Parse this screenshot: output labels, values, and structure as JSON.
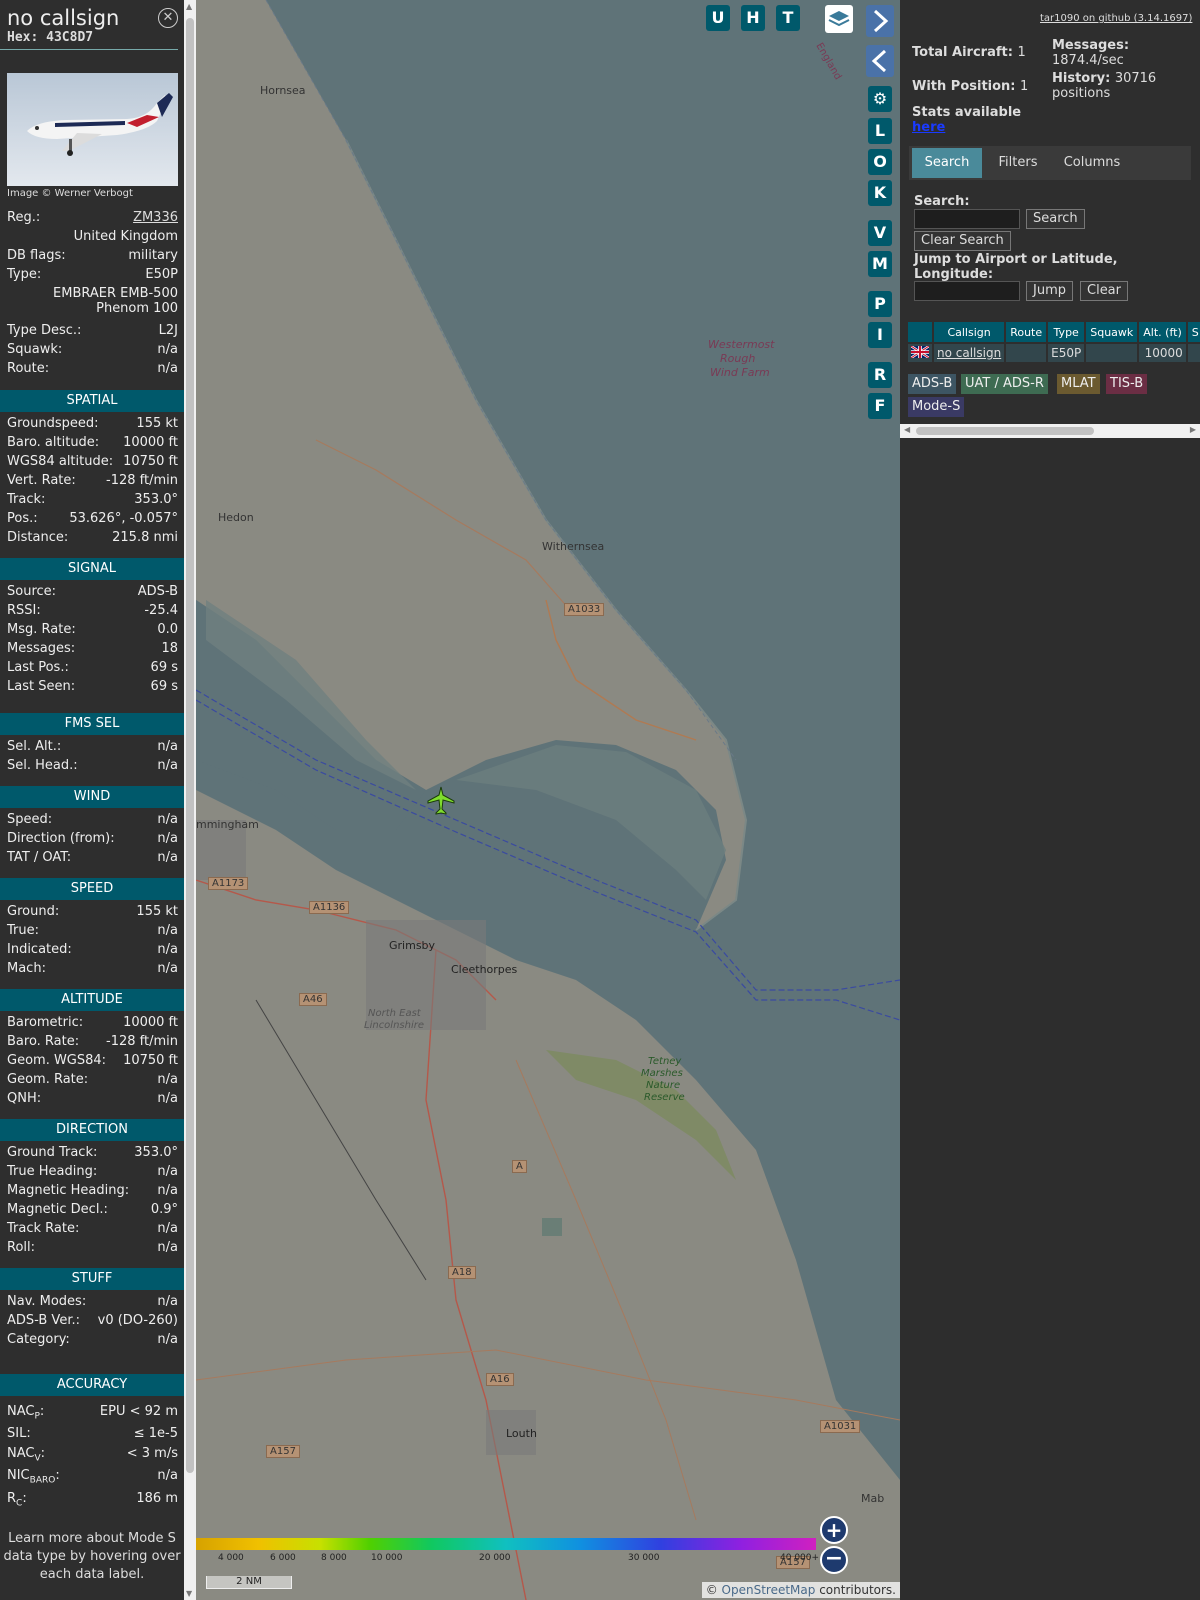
{
  "info": {
    "callsign": "no callsign",
    "hex": "Hex: 43C8D7",
    "photo_credit": "Image © Werner Verbogt",
    "reg_label": "Reg.:",
    "reg_value": "ZM336",
    "country": "United Kingdom",
    "dbflags_label": "DB flags:",
    "dbflags_value": "military",
    "type_label": "Type:",
    "type_value": "E50P",
    "type_full_1": "EMBRAER EMB-500",
    "type_full_2": "Phenom 100",
    "typedesc_label": "Type Desc.:",
    "typedesc_value": "L2J",
    "squawk_label": "Squawk:",
    "squawk_value": "n/a",
    "route_label": "Route:",
    "route_value": "n/a",
    "sections": {
      "spatial": "SPATIAL",
      "signal": "SIGNAL",
      "fms": "FMS SEL",
      "wind": "WIND",
      "speed": "SPEED",
      "altitude": "ALTITUDE",
      "direction": "DIRECTION",
      "stuff": "STUFF",
      "accuracy": "ACCURACY"
    },
    "spatial": [
      {
        "k": "Groundspeed:",
        "v": "155 kt"
      },
      {
        "k": "Baro. altitude:",
        "v": "10000 ft"
      },
      {
        "k": "WGS84 altitude:",
        "v": "10750 ft"
      },
      {
        "k": "Vert. Rate:",
        "v": "-128 ft/min"
      },
      {
        "k": "Track:",
        "v": "353.0°"
      },
      {
        "k": "Pos.:",
        "v": "53.626°, -0.057°"
      },
      {
        "k": "Distance:",
        "v": "215.8 nmi"
      }
    ],
    "signal": [
      {
        "k": "Source:",
        "v": "ADS-B"
      },
      {
        "k": "RSSI:",
        "v": "-25.4"
      },
      {
        "k": "Msg. Rate:",
        "v": "0.0"
      },
      {
        "k": "Messages:",
        "v": "18"
      },
      {
        "k": "Last Pos.:",
        "v": "69 s"
      },
      {
        "k": "Last Seen:",
        "v": "69 s"
      }
    ],
    "fms": [
      {
        "k": "Sel. Alt.:",
        "v": "n/a"
      },
      {
        "k": "Sel. Head.:",
        "v": "n/a"
      }
    ],
    "wind": [
      {
        "k": "Speed:",
        "v": "n/a"
      },
      {
        "k": "Direction (from):",
        "v": "n/a"
      },
      {
        "k": "TAT / OAT:",
        "v": "n/a"
      }
    ],
    "speed": [
      {
        "k": "Ground:",
        "v": "155 kt"
      },
      {
        "k": "True:",
        "v": "n/a"
      },
      {
        "k": "Indicated:",
        "v": "n/a"
      },
      {
        "k": "Mach:",
        "v": "n/a"
      }
    ],
    "altitude": [
      {
        "k": "Barometric:",
        "v": "10000 ft"
      },
      {
        "k": "Baro. Rate:",
        "v": "-128 ft/min"
      },
      {
        "k": "Geom. WGS84:",
        "v": "10750 ft"
      },
      {
        "k": "Geom. Rate:",
        "v": "n/a"
      },
      {
        "k": "QNH:",
        "v": "n/a"
      }
    ],
    "direction": [
      {
        "k": "Ground Track:",
        "v": "353.0°"
      },
      {
        "k": "True Heading:",
        "v": "n/a"
      },
      {
        "k": "Magnetic Heading:",
        "v": "n/a"
      },
      {
        "k": "Magnetic Decl.:",
        "v": "0.9°"
      },
      {
        "k": "Track Rate:",
        "v": "n/a"
      },
      {
        "k": "Roll:",
        "v": "n/a"
      }
    ],
    "stuff": [
      {
        "k": "Nav. Modes:",
        "v": "n/a"
      },
      {
        "k": "ADS-B Ver.:",
        "v": "v0 (DO-260)"
      },
      {
        "k": "Category:",
        "v": "n/a"
      }
    ],
    "accuracy": {
      "nacp_k": "NAC",
      "nacp_sub": "P",
      "nacp_v": "EPU < 92 m",
      "sil_k": "SIL:",
      "sil_v": "≤ 1e-5",
      "nacv_k": "NAC",
      "nacv_sub": "V",
      "nacv_v": "< 3 m/s",
      "nic_k": "NIC",
      "nic_sub": "BARO",
      "nic_v": "n/a",
      "rc_k": "R",
      "rc_sub": "C",
      "rc_v": "186 m"
    },
    "learn_more": "Learn more about Mode S data type by hovering over each data label."
  },
  "map": {
    "buttons_top": [
      "U",
      "H",
      "T"
    ],
    "buttons_side": [
      "L",
      "O",
      "K",
      "V",
      "M",
      "P",
      "I",
      "R",
      "F"
    ],
    "labels": [
      "Hornsea",
      "Hedon",
      "Withernsea",
      "Westermost",
      "Rough",
      "Wind Farm",
      "mmingham",
      "Grimsby",
      "Cleethorpes",
      "North East",
      "Lincolnshire",
      "Tetney",
      "Marshes",
      "Nature",
      "Reserve",
      "Louth",
      "England",
      "Mab"
    ],
    "roads": [
      "A1033",
      "A1173",
      "A1136",
      "A46",
      "A",
      "A18",
      "A16",
      "A157",
      "A1031",
      "A157"
    ],
    "altitude_scale": [
      "4 000",
      "6 000",
      "8 000",
      "10 000",
      "20 000",
      "30 000",
      "40 000+"
    ],
    "scale_bar": "2 NM",
    "attribution_prefix": "© ",
    "attribution_link": "OpenStreetMap",
    "attribution_suffix": " contributors."
  },
  "right": {
    "github": "tar1090 on github (3.14.1697)",
    "total_label": "Total Aircraft:",
    "total_value": "1",
    "withpos_label": "With Position:",
    "withpos_value": "1",
    "messages_label": "Messages:",
    "messages_value": "1874.4/sec",
    "history_label": "History:",
    "history_value": "30716",
    "history_suffix": "positions",
    "stats_label": "Stats available",
    "stats_link": "here",
    "tabs": [
      "Search",
      "Filters",
      "Columns"
    ],
    "search_label": "Search:",
    "search_btn": "Search",
    "clear_search_btn": "Clear Search",
    "jump_label": "Jump to Airport or Latitude, Longitude:",
    "jump_btn": "Jump",
    "clear_btn": "Clear",
    "columns": [
      "",
      "Callsign",
      "Route",
      "Type",
      "Squawk",
      "Alt. (ft)",
      "S"
    ],
    "row": {
      "callsign": "no callsign",
      "route": "",
      "type": "E50P",
      "squawk": "",
      "alt": "10000"
    },
    "badges": [
      "ADS-B",
      "UAT / ADS-R",
      "MLAT",
      "TIS-B",
      "Mode-S"
    ]
  }
}
